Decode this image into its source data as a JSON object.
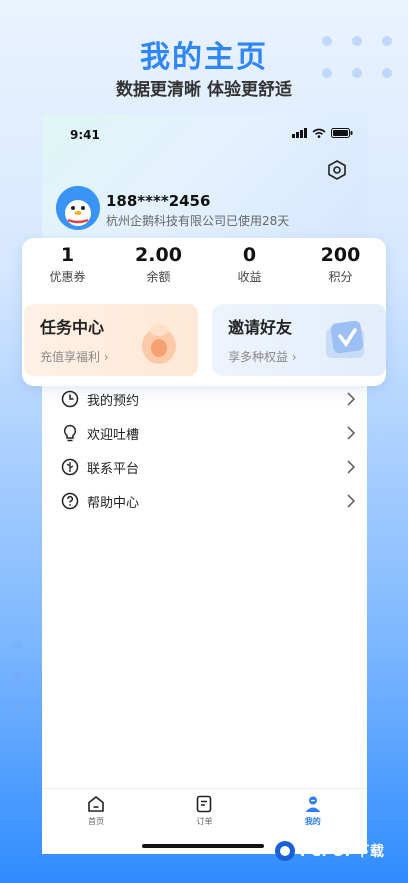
{
  "promo": {
    "title": "我的主页",
    "subtitle": "数据更清晰 体验更舒适"
  },
  "status_bar": {
    "time": "9:41"
  },
  "profile": {
    "phone": "188****2456",
    "org_line": "杭州企鹅科技有限公司已使用28天"
  },
  "stats": [
    {
      "value": "1",
      "label": "优惠券"
    },
    {
      "value": "2.00",
      "label": "余额"
    },
    {
      "value": "0",
      "label": "收益"
    },
    {
      "value": "200",
      "label": "积分"
    }
  ],
  "cards": {
    "task": {
      "title": "任务中心",
      "subtitle": "充值享福利 ›"
    },
    "invite": {
      "title": "邀请好友",
      "subtitle": "享多种权益 ›"
    }
  },
  "menu": [
    {
      "label": "我的预约",
      "icon": "clock-icon"
    },
    {
      "label": "欢迎吐槽",
      "icon": "lightbulb-icon"
    },
    {
      "label": "联系平台",
      "icon": "leaf-icon"
    },
    {
      "label": "帮助中心",
      "icon": "question-icon"
    }
  ],
  "tabs": [
    {
      "label": "首页",
      "icon": "home-icon"
    },
    {
      "label": "订单",
      "icon": "order-icon"
    },
    {
      "label": "我的",
      "icon": "user-icon",
      "active": true
    }
  ],
  "watermark": {
    "text": "PCPOP下载"
  },
  "colors": {
    "accent": "#2f86f6",
    "active_tab": "#2d7cf6"
  }
}
